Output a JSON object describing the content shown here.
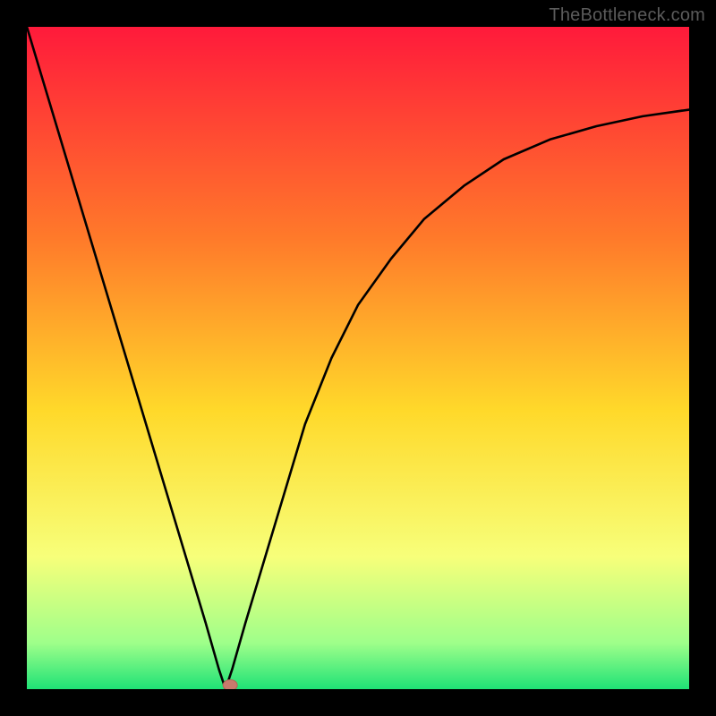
{
  "watermark": "TheBottleneck.com",
  "colors": {
    "frame": "#000000",
    "gradient_top": "#ff1a3b",
    "gradient_upper_mid": "#ff7a2a",
    "gradient_mid": "#ffd92a",
    "gradient_lower_mid": "#f7ff7a",
    "gradient_near_bottom": "#9fff8a",
    "gradient_bottom": "#1fe276",
    "curve": "#000000",
    "marker_fill": "#c97a6d",
    "marker_stroke": "#b56457"
  },
  "chart_data": {
    "type": "line",
    "title": "",
    "xlabel": "",
    "ylabel": "",
    "xlim": [
      0,
      100
    ],
    "ylim": [
      0,
      100
    ],
    "grid": false,
    "legend": false,
    "series": [
      {
        "name": "bottleneck-curve",
        "x": [
          0,
          3,
          6,
          9,
          12,
          15,
          18,
          21,
          24,
          27,
          29,
          30,
          31,
          33,
          36,
          39,
          42,
          46,
          50,
          55,
          60,
          66,
          72,
          79,
          86,
          93,
          100
        ],
        "values": [
          100,
          90,
          80,
          70,
          60,
          50,
          40,
          30,
          20,
          10,
          3,
          0,
          3,
          10,
          20,
          30,
          40,
          50,
          58,
          65,
          71,
          76,
          80,
          83,
          85,
          86.5,
          87.5
        ]
      }
    ],
    "marker": {
      "name": "optimal-point",
      "x": 30.7,
      "y": 0.6
    }
  }
}
